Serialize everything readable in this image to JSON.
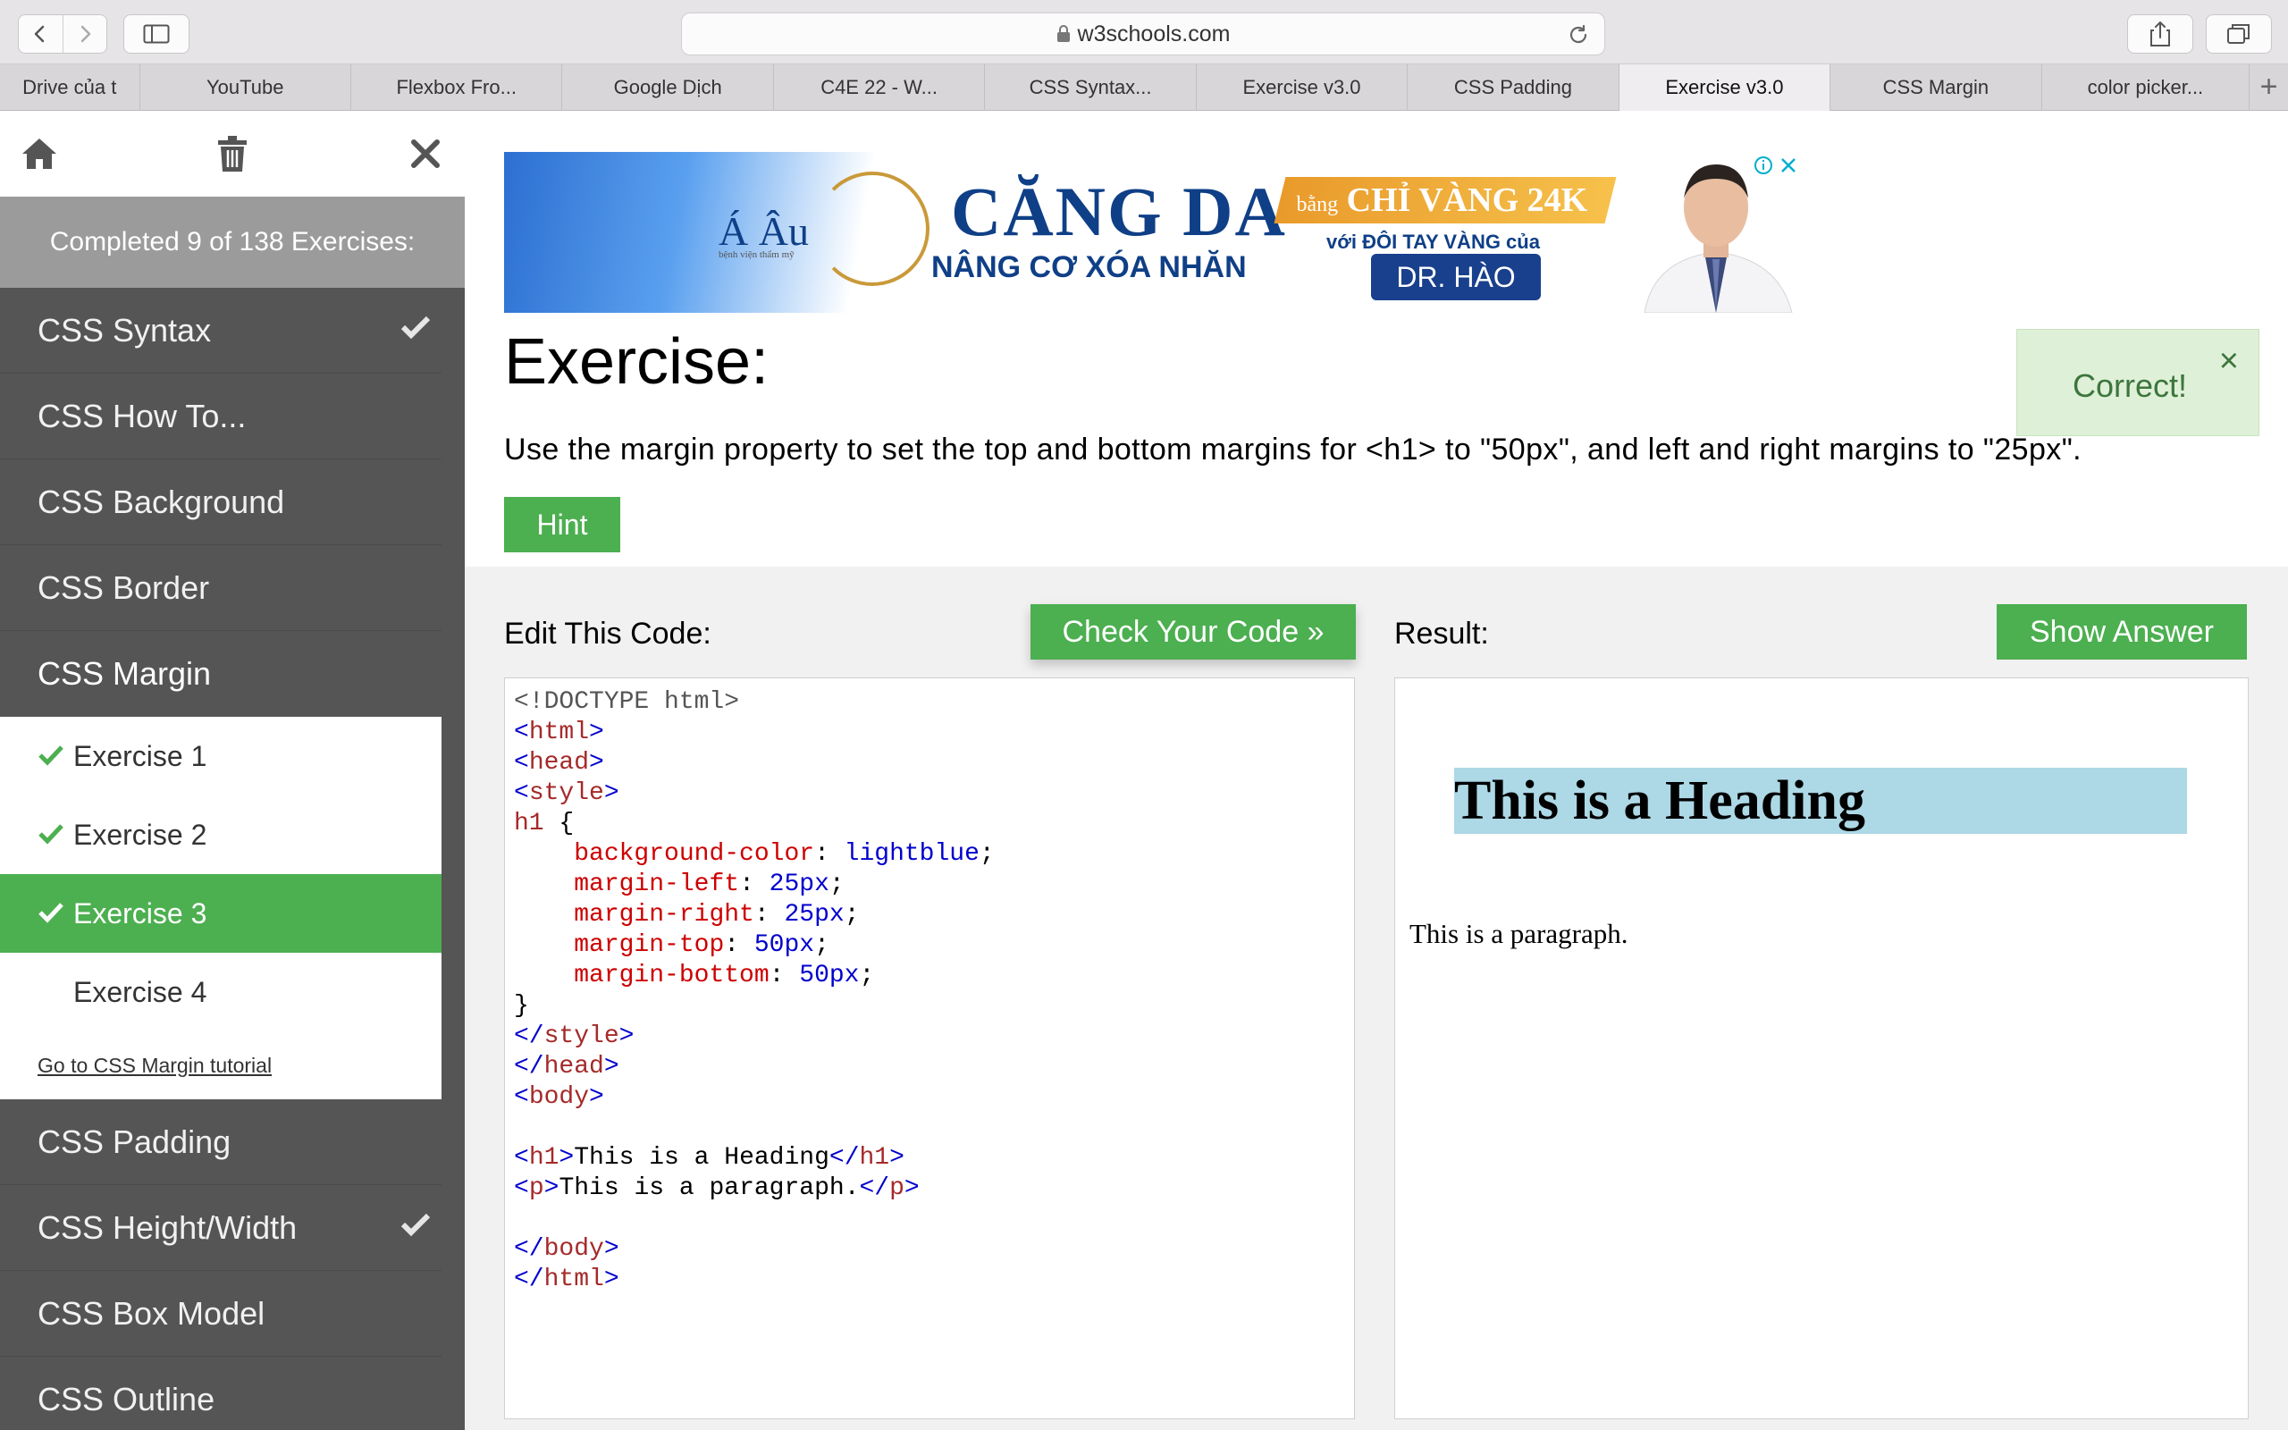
{
  "browser": {
    "url": "w3schools.com",
    "tabs": [
      {
        "label": "Drive của t",
        "active": false
      },
      {
        "label": "YouTube",
        "active": false
      },
      {
        "label": "Flexbox Fro...",
        "active": false
      },
      {
        "label": "Google Dịch",
        "active": false
      },
      {
        "label": "C4E 22 - W...",
        "active": false
      },
      {
        "label": "CSS Syntax...",
        "active": false
      },
      {
        "label": "Exercise v3.0",
        "active": false
      },
      {
        "label": "CSS Padding",
        "active": false
      },
      {
        "label": "Exercise v3.0",
        "active": true
      },
      {
        "label": "CSS Margin",
        "active": false
      },
      {
        "label": "color picker...",
        "active": false
      }
    ]
  },
  "sidebar": {
    "progress": "Completed 9 of 138 Exercises:",
    "categories_top": [
      {
        "label": "CSS Syntax",
        "done": true
      },
      {
        "label": "CSS How To...",
        "done": false
      },
      {
        "label": "CSS Background",
        "done": false
      },
      {
        "label": "CSS Border",
        "done": false
      },
      {
        "label": "CSS Margin",
        "done": false
      }
    ],
    "exercises": [
      {
        "label": "Exercise 1",
        "done": true,
        "active": false
      },
      {
        "label": "Exercise 2",
        "done": true,
        "active": false
      },
      {
        "label": "Exercise 3",
        "done": true,
        "active": true
      },
      {
        "label": "Exercise 4",
        "done": false,
        "active": false
      }
    ],
    "tutorial_link": "Go to CSS Margin tutorial",
    "categories_bottom": [
      {
        "label": "CSS Padding",
        "done": false
      },
      {
        "label": "CSS Height/Width",
        "done": true
      },
      {
        "label": "CSS Box Model",
        "done": false
      },
      {
        "label": "CSS Outline",
        "done": false
      }
    ]
  },
  "ad": {
    "brand": "Á Âu",
    "brand_sub": "bệnh viện thẩm mỹ",
    "headline": "CĂNG DA",
    "subline": "NÂNG CƠ XÓA NHĂN",
    "gold_prefix": "bằng",
    "gold_text": "CHỈ VÀNG 24K",
    "with_text": "với ĐÔI TAY VÀNG của",
    "doctor": "DR. HÀO"
  },
  "exercise": {
    "title": "Exercise:",
    "description": "Use the margin property to set the top and bottom margins for <h1> to \"50px\", and left and right margins to \"25px\".",
    "hint_label": "Hint",
    "correct_label": "Correct!",
    "close_symbol": "×"
  },
  "editor": {
    "title": "Edit This Code:",
    "check_label": "Check Your Code »",
    "lines": [
      [
        {
          "c": "doctype",
          "t": "<!DOCTYPE html>"
        }
      ],
      [
        {
          "c": "br",
          "t": "<"
        },
        {
          "c": "tag",
          "t": "html"
        },
        {
          "c": "br",
          "t": ">"
        }
      ],
      [
        {
          "c": "br",
          "t": "<"
        },
        {
          "c": "tag",
          "t": "head"
        },
        {
          "c": "br",
          "t": ">"
        }
      ],
      [
        {
          "c": "br",
          "t": "<"
        },
        {
          "c": "tag",
          "t": "style"
        },
        {
          "c": "br",
          "t": ">"
        }
      ],
      [
        {
          "c": "tag",
          "t": "h1"
        },
        {
          "c": "plain",
          "t": " {"
        }
      ],
      [
        {
          "c": "plain",
          "t": "    "
        },
        {
          "c": "prop",
          "t": "background-color"
        },
        {
          "c": "plain",
          "t": ": "
        },
        {
          "c": "val",
          "t": "lightblue"
        },
        {
          "c": "plain",
          "t": ";"
        }
      ],
      [
        {
          "c": "plain",
          "t": "    "
        },
        {
          "c": "prop",
          "t": "margin-left"
        },
        {
          "c": "plain",
          "t": ": "
        },
        {
          "c": "val",
          "t": "25px"
        },
        {
          "c": "plain",
          "t": ";"
        }
      ],
      [
        {
          "c": "plain",
          "t": "    "
        },
        {
          "c": "prop",
          "t": "margin-right"
        },
        {
          "c": "plain",
          "t": ": "
        },
        {
          "c": "val",
          "t": "25px"
        },
        {
          "c": "plain",
          "t": ";"
        }
      ],
      [
        {
          "c": "plain",
          "t": "    "
        },
        {
          "c": "prop",
          "t": "margin-top"
        },
        {
          "c": "plain",
          "t": ": "
        },
        {
          "c": "val",
          "t": "50px"
        },
        {
          "c": "plain",
          "t": ";"
        }
      ],
      [
        {
          "c": "plain",
          "t": "    "
        },
        {
          "c": "prop",
          "t": "margin-bottom"
        },
        {
          "c": "plain",
          "t": ": "
        },
        {
          "c": "val",
          "t": "50px"
        },
        {
          "c": "plain",
          "t": ";"
        }
      ],
      [
        {
          "c": "plain",
          "t": "}"
        }
      ],
      [
        {
          "c": "br",
          "t": "</"
        },
        {
          "c": "tag",
          "t": "style"
        },
        {
          "c": "br",
          "t": ">"
        }
      ],
      [
        {
          "c": "br",
          "t": "</"
        },
        {
          "c": "tag",
          "t": "head"
        },
        {
          "c": "br",
          "t": ">"
        }
      ],
      [
        {
          "c": "br",
          "t": "<"
        },
        {
          "c": "tag",
          "t": "body"
        },
        {
          "c": "br",
          "t": ">"
        }
      ],
      [],
      [
        {
          "c": "br",
          "t": "<"
        },
        {
          "c": "tag",
          "t": "h1"
        },
        {
          "c": "br",
          "t": ">"
        },
        {
          "c": "plain",
          "t": "This is a Heading"
        },
        {
          "c": "br",
          "t": "</"
        },
        {
          "c": "tag",
          "t": "h1"
        },
        {
          "c": "br",
          "t": ">"
        }
      ],
      [
        {
          "c": "br",
          "t": "<"
        },
        {
          "c": "tag",
          "t": "p"
        },
        {
          "c": "br",
          "t": ">"
        },
        {
          "c": "plain",
          "t": "This is a paragraph."
        },
        {
          "c": "br",
          "t": "</"
        },
        {
          "c": "tag",
          "t": "p"
        },
        {
          "c": "br",
          "t": ">"
        }
      ],
      [],
      [
        {
          "c": "br",
          "t": "</"
        },
        {
          "c": "tag",
          "t": "body"
        },
        {
          "c": "br",
          "t": ">"
        }
      ],
      [
        {
          "c": "br",
          "t": "</"
        },
        {
          "c": "tag",
          "t": "html"
        },
        {
          "c": "br",
          "t": ">"
        }
      ]
    ]
  },
  "result": {
    "title": "Result:",
    "show_answer_label": "Show Answer",
    "heading": "This is a Heading",
    "paragraph": "This is a paragraph."
  },
  "colors": {
    "w3_green": "#4caf50",
    "sidebar_dark": "#555555",
    "heading_bg": "#add8e6",
    "correct_bg": "#dff0d8",
    "correct_text": "#3c763d"
  }
}
